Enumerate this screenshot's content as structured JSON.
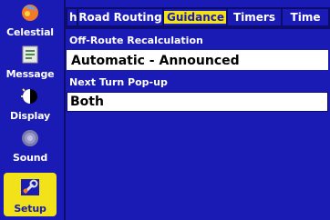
{
  "sidebar": {
    "items": [
      {
        "label": "Celestial",
        "icon": "celestial-icon"
      },
      {
        "label": "Message",
        "icon": "message-icon"
      },
      {
        "label": "Display",
        "icon": "display-icon"
      },
      {
        "label": "Sound",
        "icon": "sound-icon"
      },
      {
        "label": "Setup",
        "icon": "setup-icon"
      }
    ],
    "active": "Setup"
  },
  "tabs": [
    {
      "label": "h"
    },
    {
      "label": "Road Routing"
    },
    {
      "label": "Guidance"
    },
    {
      "label": "Timers"
    },
    {
      "label": "Time"
    }
  ],
  "active_tab": "Guidance",
  "fields": {
    "off_route": {
      "label": "Off-Route Recalculation",
      "value": "Automatic - Announced"
    },
    "next_turn": {
      "label": "Next Turn Pop-up",
      "value": "Both"
    }
  },
  "colors": {
    "background": "#1a1ab5",
    "highlight": "#f2e21a",
    "field": "#ffffff"
  }
}
